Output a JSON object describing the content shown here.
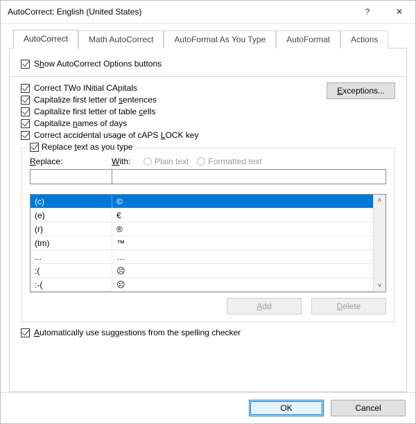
{
  "window": {
    "title": "AutoCorrect: English (United States)",
    "help_glyph": "?",
    "close_glyph": "✕"
  },
  "tabs": {
    "autocorrect": "AutoCorrect",
    "math": "Math AutoCorrect",
    "asyoutype": "AutoFormat As You Type",
    "autoformat": "AutoFormat",
    "actions": "Actions"
  },
  "options": {
    "show_buttons_pre": "S",
    "show_buttons_u": "h",
    "show_buttons_post": "ow AutoCorrect Options buttons",
    "two_initial": "Correct TWo INitial CApitals",
    "first_sentence_pre": "Capitalize first letter of ",
    "first_sentence_u": "s",
    "first_sentence_post": "entences",
    "table_cells_pre": "Capitalize first letter of table ",
    "table_cells_u": "c",
    "table_cells_post": "ells",
    "names_days_pre": "Capitalize ",
    "names_days_u": "n",
    "names_days_post": "ames of days",
    "caps_lock_pre": "Correct accidental usage of cAPS ",
    "caps_lock_u": "L",
    "caps_lock_post": "OCK key",
    "exceptions_u": "E",
    "exceptions_post": "xceptions..."
  },
  "replace_section": {
    "legend_pre": "Replace ",
    "legend_u": "t",
    "legend_post": "ext as you type",
    "replace_u": "R",
    "replace_post": "eplace:",
    "with_u": "W",
    "with_post": "ith:",
    "plain": "Plain text",
    "formatted": "Formatted text"
  },
  "list": [
    {
      "a": "(c)",
      "b": "©"
    },
    {
      "a": "(e)",
      "b": "€"
    },
    {
      "a": "(r)",
      "b": "®"
    },
    {
      "a": "(tm)",
      "b": "™"
    },
    {
      "a": "...",
      "b": "…"
    },
    {
      "a": ":(",
      "b": "☹"
    },
    {
      "a": ":-(",
      "b": "☹"
    }
  ],
  "scroll": {
    "up": "˄",
    "down": "˅"
  },
  "buttons": {
    "add_u": "A",
    "add_post": "dd",
    "delete_u": "D",
    "delete_post": "elete",
    "ok": "OK",
    "cancel": "Cancel"
  },
  "spellcheck": {
    "pre": "A",
    "post": "utomatically use suggestions from the spelling checker"
  }
}
